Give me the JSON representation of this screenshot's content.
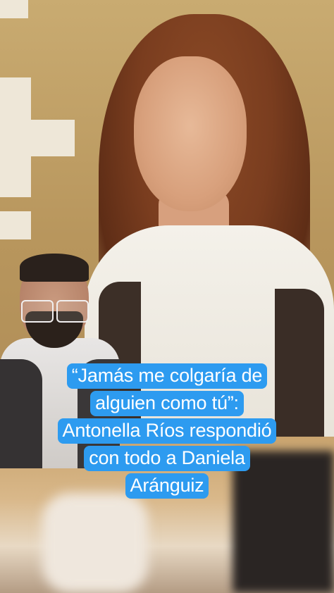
{
  "caption": {
    "lines": [
      "“Jamás me colgaría de",
      "alguien como tú”:",
      "Antonella Ríos respondió",
      "con todo a Daniela",
      "Aránguiz"
    ],
    "background_color": "#2d9bf0",
    "text_color": "#ffffff"
  }
}
